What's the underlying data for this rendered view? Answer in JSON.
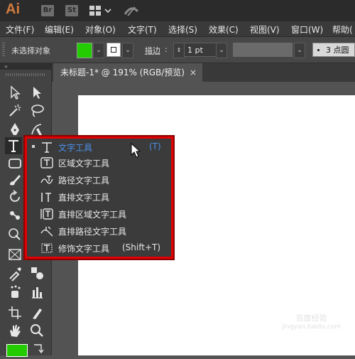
{
  "app": {
    "logo": "Ai",
    "icons": [
      "Br",
      "St"
    ]
  },
  "menu": [
    "文件(F)",
    "编辑(E)",
    "对象(O)",
    "文字(T)",
    "选择(S)",
    "效果(C)",
    "视图(V)",
    "窗口(W)",
    "帮助("
  ],
  "control_bar": {
    "selection_label": "未选择对象",
    "fill_color": "#22cc00",
    "stroke_label": "描边",
    "stroke_value": "1 pt",
    "brush_value": "3 点圆"
  },
  "document_tab": {
    "title": "未标题-1* @ 191% (RGB/预览)",
    "close": "×"
  },
  "flyout": {
    "items": [
      {
        "label": "文字工具",
        "shortcut": "(T)",
        "icon": "type-icon"
      },
      {
        "label": "区域文字工具",
        "shortcut": "",
        "icon": "area-type-icon"
      },
      {
        "label": "路径文字工具",
        "shortcut": "",
        "icon": "type-on-path-icon"
      },
      {
        "label": "直排文字工具",
        "shortcut": "",
        "icon": "vertical-type-icon"
      },
      {
        "label": "直排区域文字工具",
        "shortcut": "",
        "icon": "vertical-area-type-icon"
      },
      {
        "label": "直排路径文字工具",
        "shortcut": "",
        "icon": "vertical-type-on-path-icon"
      },
      {
        "label": "修饰文字工具",
        "shortcut": "(Shift+T)",
        "icon": "touch-type-icon"
      }
    ]
  },
  "colors": {
    "accent": "#4a90e8",
    "highlight_border": "#e00000",
    "fill": "#22cc00"
  },
  "watermark": {
    "line1": "百度经验",
    "line2": "jingyan.baidu.com"
  }
}
